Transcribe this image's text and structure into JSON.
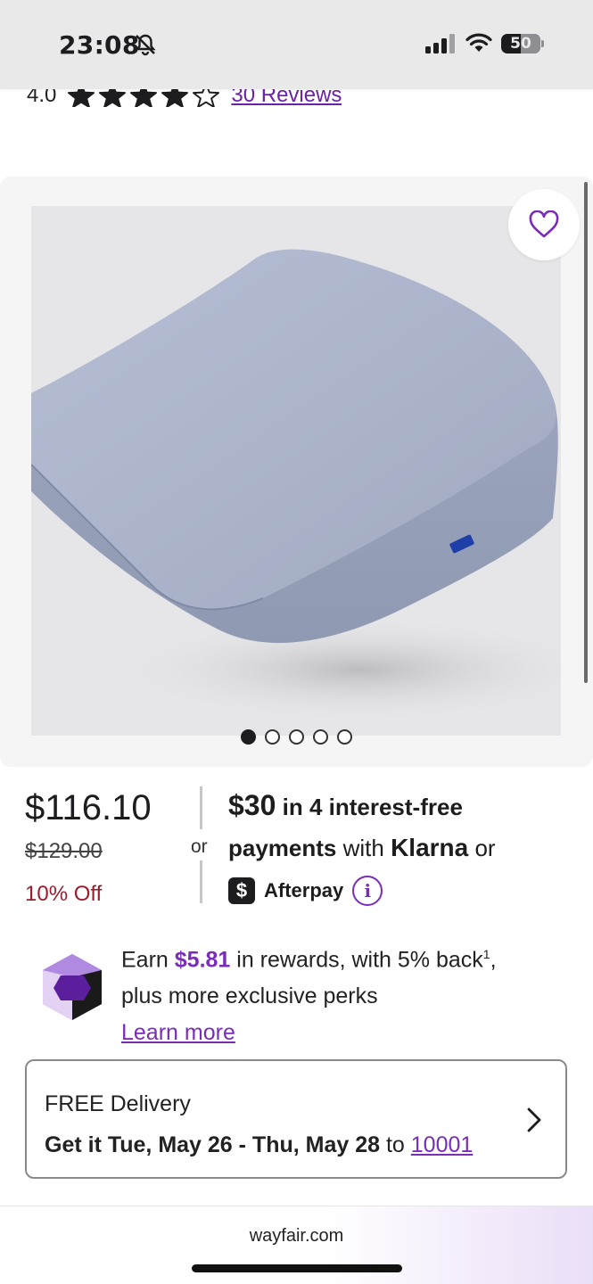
{
  "status_bar": {
    "time": "23:08",
    "battery": "50"
  },
  "rating": {
    "value": "4.0",
    "stars_filled": 4,
    "stars_total": 5,
    "reviews_label": "30 Reviews"
  },
  "gallery": {
    "image_count": 5,
    "active_index": 0,
    "favorite_icon": "heart-outline-icon"
  },
  "price": {
    "current": "$116.10",
    "original": "$129.00",
    "discount": "10% Off"
  },
  "payment": {
    "or_label": "or",
    "amount": "$30",
    "line1_rest": " in 4 interest-free",
    "line2_strong": "payments",
    "line2_with": " with ",
    "klarna": "Klarna",
    "line2_or": " or",
    "afterpay_logo": "$",
    "afterpay": "Afterpay",
    "info": "i"
  },
  "rewards": {
    "earn": "Earn ",
    "amount": "$5.81",
    "rest": " in rewards, with 5% back",
    "footnote": "1",
    "comma": ",",
    "line2": "plus more exclusive perks",
    "learn_more": "Learn more"
  },
  "delivery": {
    "title": "FREE Delivery",
    "date": "Get it Tue, May 26 - Thu, May 28",
    "to": " to ",
    "zip": "10001"
  },
  "browser": {
    "url": "wayfair.com"
  },
  "colors": {
    "accent": "#7b2cb8",
    "discount": "#9b1c2c"
  }
}
